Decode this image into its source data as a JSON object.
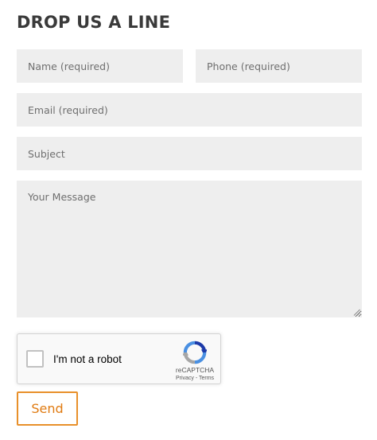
{
  "form": {
    "title": "DROP US A LINE",
    "name_placeholder": "Name (required)",
    "phone_placeholder": "Phone (required)",
    "email_placeholder": "Email (required)",
    "subject_placeholder": "Subject",
    "message_placeholder": "Your Message",
    "send_label": "Send"
  },
  "recaptcha": {
    "label": "I'm not a robot",
    "brand": "reCAPTCHA",
    "privacy": "Privacy",
    "separator": " - ",
    "terms": "Terms",
    "checked": false,
    "icon": "recaptcha-logo-icon"
  },
  "colors": {
    "accent": "#e8902a",
    "field_background": "#eeeeee",
    "title": "#3a3a3a"
  }
}
